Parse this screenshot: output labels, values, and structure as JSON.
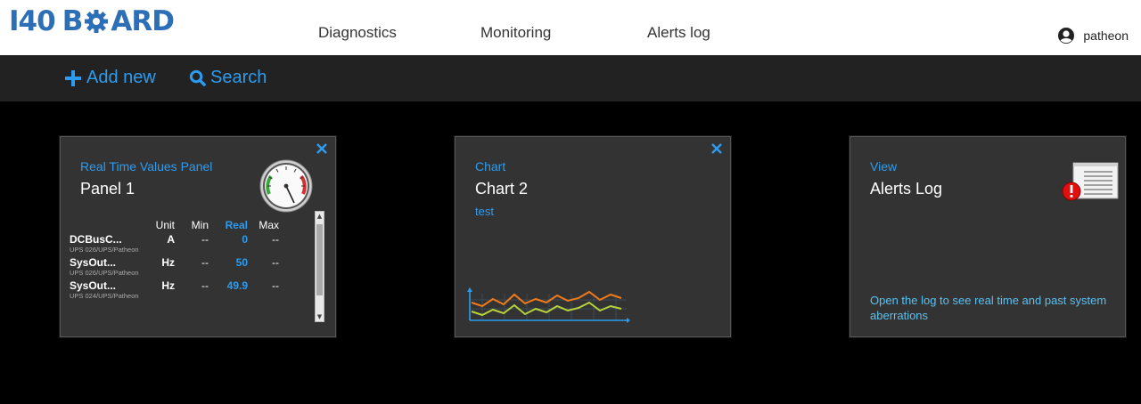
{
  "app": {
    "logo_prefix": "I4",
    "logo_zero": "0",
    "logo_b": "B",
    "logo_rest": "ARD"
  },
  "nav": [
    {
      "label": "Diagnostics"
    },
    {
      "label": "Monitoring"
    },
    {
      "label": "Alerts log"
    }
  ],
  "user": {
    "name": "patheon"
  },
  "toolbar": {
    "add_label": "Add new",
    "search_label": "Search"
  },
  "cards": {
    "panel": {
      "category": "Real Time Values Panel",
      "title": "Panel 1",
      "columns": {
        "unit": "Unit",
        "min": "Min",
        "real": "Real",
        "max": "Max"
      },
      "rows": [
        {
          "name": "DCBusC...",
          "unit": "A",
          "min": "--",
          "real": "0",
          "max": "--",
          "source": "UPS 026/UPS/Patheon"
        },
        {
          "name": "SysOut...",
          "unit": "Hz",
          "min": "--",
          "real": "50",
          "max": "--",
          "source": "UPS 026/UPS/Patheon"
        },
        {
          "name": "SysOut...",
          "unit": "Hz",
          "min": "--",
          "real": "49.9",
          "max": "--",
          "source": "UPS 024/UPS/Patheon"
        }
      ]
    },
    "chart": {
      "category": "Chart",
      "title": "Chart 2",
      "subtitle": "test"
    },
    "view": {
      "category": "View",
      "title": "Alerts Log",
      "description": "Open the log to see real time and past system aberrations"
    }
  },
  "colors": {
    "accent": "#2d9cf0",
    "brand": "#2d6fb7",
    "card_bg": "#333333",
    "toolbar_bg": "#222222",
    "chart_orange": "#f07a1a",
    "chart_yellow": "#b8d23a",
    "alert_red": "#e01010"
  },
  "icons": {
    "add": "plus-icon",
    "search": "search-icon",
    "user": "user-icon",
    "close": "close-icon",
    "gauge": "gauge-icon",
    "chart": "line-chart-icon",
    "alerts": "alert-log-icon"
  }
}
